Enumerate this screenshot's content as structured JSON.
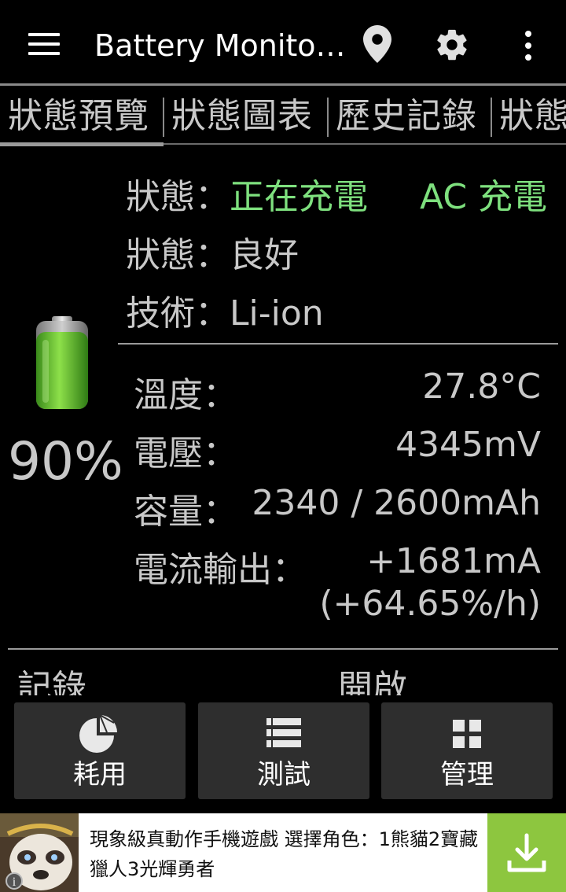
{
  "app_bar": {
    "title": "Battery Monito…",
    "icons": [
      "menu-icon",
      "location-pin-icon",
      "gear-icon",
      "more-vert-icon"
    ]
  },
  "tabs": [
    {
      "label": "狀態預覽",
      "selected": true
    },
    {
      "label": "狀態圖表",
      "selected": false
    },
    {
      "label": "歷史記錄",
      "selected": false
    },
    {
      "label": "狀態",
      "selected": false
    }
  ],
  "status": {
    "state_label": "狀態：",
    "state_value": "正在充電",
    "charge_source": "AC 充電",
    "health_label": "狀態：",
    "health_value": "良好",
    "tech_label": "技術：",
    "tech_value": "Li-ion"
  },
  "battery": {
    "percent_text": "90%",
    "level": 0.9
  },
  "details": {
    "temp_label": "溫度：",
    "temp_value": "27.8°C",
    "voltage_label": "電壓：",
    "voltage_value": "4345mV",
    "capacity_label": "容量：",
    "capacity_value": "2340 / 2600mAh",
    "current_label": "電流輸出：",
    "current_value": "+1681mA",
    "current_rate": "(+64.65%/h)"
  },
  "section": {
    "left_label": "記錄",
    "right_label": "開啟"
  },
  "buttons": {
    "usage": "耗用",
    "test": "測試",
    "manage": "管理"
  },
  "ad": {
    "text": "現象級真動作手機遊戲 選擇角色：1熊貓2寶藏獵人3光輝勇者",
    "download_color": "#8dc63f"
  },
  "colors": {
    "accent_green": "#7ee07e",
    "background": "#000000",
    "button_bg": "#2e2e2e"
  }
}
